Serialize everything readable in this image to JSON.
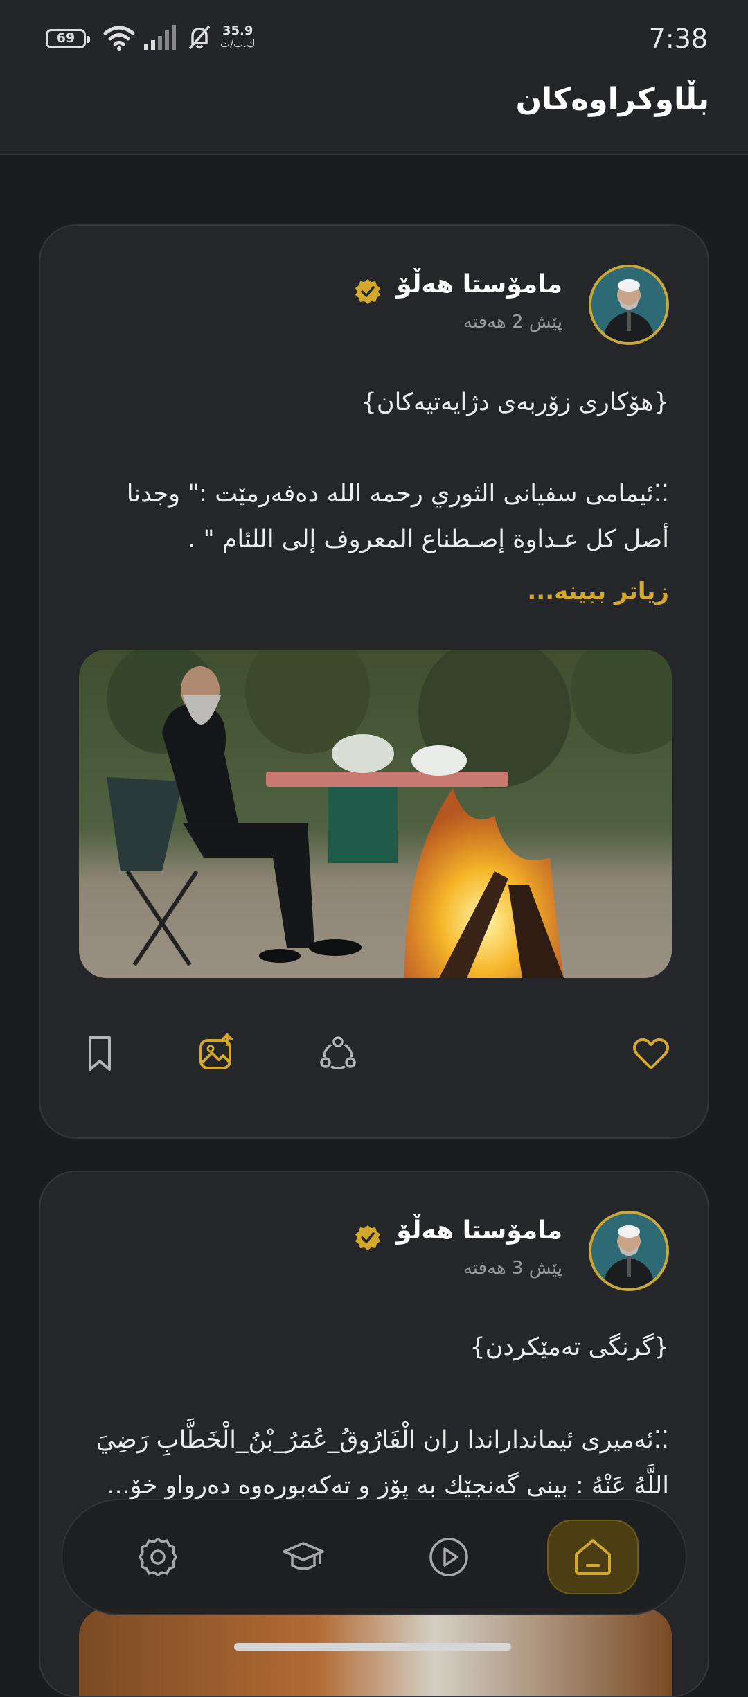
{
  "status": {
    "time": "7:38",
    "battery": "69",
    "net_speed": "35.9",
    "net_unit": "ك.ب/ث"
  },
  "header": {
    "title": "بڵاوکراوەکان"
  },
  "posts": [
    {
      "author": "مامۆستا هەڵۆ",
      "time_ago": "پێش 2 هەفتە",
      "headline": "{هۆکاری زۆربەی دژایەتیەکان}",
      "body": "⁚⁚ئیمامی سفیانی الثوري رحمه الله دەفەرمێت  :\" وجدنا أصل كل عـداوة إصـطناع المعروف إلى اللئام \" .",
      "more": "زیاتر ببینە..."
    },
    {
      "author": "مامۆستا هەڵۆ",
      "time_ago": "پێش 3 هەفتە",
      "headline": "{گرنگی تەمێکردن}",
      "body": "⁚⁚ئەمیری ئیمانداراندا ران الْفَارُوقُ_عُمَرُ_بْنُ_الْخَطَّابِ رَضِيَ اللَّهُ عَنْهُ : بینی گەنجێك بە پۆز و تەکەبورەوە دەرواو خۆ..."
    }
  ],
  "icons": {
    "verified": "verified-badge-icon",
    "bookmark": "bookmark-icon",
    "share_image": "image-share-icon",
    "share": "share-icon",
    "like": "heart-icon"
  },
  "nav": {
    "items": [
      "settings-icon",
      "graduation-cap-icon",
      "play-icon",
      "home-icon"
    ],
    "active": "home-icon"
  },
  "colors": {
    "accent": "#d4a82c",
    "background": "#1b1c1e",
    "card": "#242629"
  }
}
